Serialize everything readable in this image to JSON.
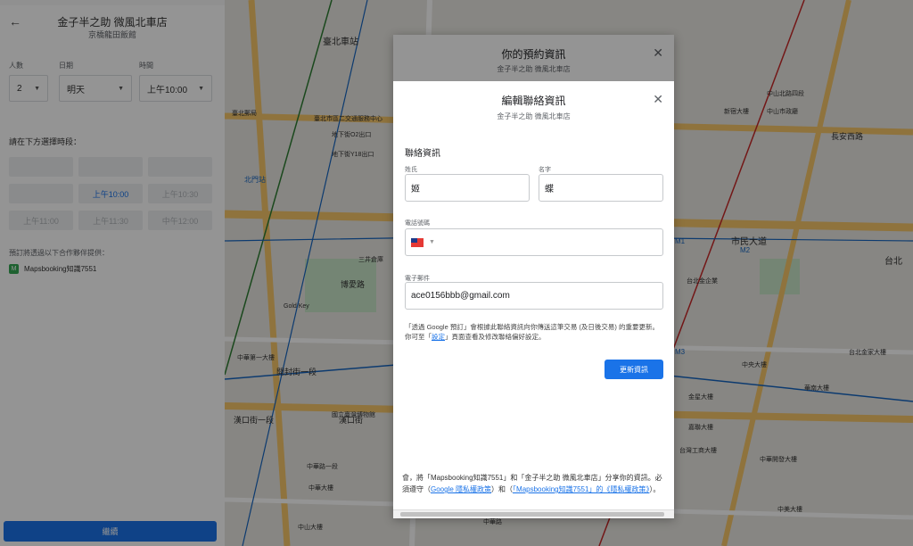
{
  "left_panel": {
    "restaurant_name": "金子半之助 微風北車店",
    "subtitle": "京橋龍田飯館",
    "party_size_label": "人數",
    "party_size_value": "2",
    "date_label": "日期",
    "date_value": "明天",
    "time_label": "時間",
    "time_value": "上午10:00",
    "slot_prompt": "請在下方選擇時段：",
    "slots": [
      "上午10:00",
      "上午10:30",
      "上午11:00",
      "上午11:30",
      "中午12:00"
    ],
    "provider_note": "預訂將透過以下合作夥伴提供：",
    "provider_name": "Mapsbooking知識7551",
    "continue_label": "繼續"
  },
  "map": {
    "labels": [
      "臺北車站",
      "北門站",
      "臺北郵局",
      "臺北市區二交通服務中心",
      "國立臺灣博物館",
      "博愛路",
      "Gold Key",
      "開封街一段",
      "漢口街一段",
      "漢口街",
      "中華路一段",
      "中華路",
      "中山北路四段",
      "長安西路",
      "中山市政廳",
      "地下街O2出口",
      "地下街Y18出口",
      "市民大道",
      "M2",
      "M1",
      "M3",
      "台北",
      "三井倉庫",
      "中華第一大樓",
      "台北金企業",
      "中央大樓",
      "金星大樓",
      "中美大樓",
      "中山大樓",
      "華南大樓",
      "台北金家大樓",
      "台灣工商大樓",
      "嘉聯大樓",
      "新宿大樓",
      "中華開發大樓",
      "中華大樓"
    ]
  },
  "booking_dialog": {
    "title": "你的預約資訊",
    "subtitle": "金子半之助 微風北車店",
    "footer_pre": "會，將「Mapsbooking知識7551」和「金子半之助 微風北車店」分享你的資訊。必須遵守（",
    "footer_link1": "Google 隱私權政策",
    "footer_mid": "）和（",
    "footer_link2": "「Mapsbooking知識7551」的《隱私權政策》",
    "footer_post": "）。"
  },
  "edit_dialog": {
    "title": "編輯聯絡資訊",
    "subtitle": "金子半之助 微風北車店",
    "section_title": "聯絡資訊",
    "last_name_label": "姓氏",
    "last_name_value": "姬",
    "first_name_label": "名字",
    "first_name_value": "蝶",
    "phone_label": "電話號碼",
    "phone_value": "",
    "email_label": "電子郵件",
    "email_value": "ace0156bbb@gmail.com",
    "privacy_pre": "「透過 Google 預訂」會根據此聯絡資訊向你傳送這筆交易 (及日後交易) 的重要更新。你可至「",
    "privacy_link": "設定",
    "privacy_post": "」頁面查看及修改聯絡偏好設定。",
    "update_label": "更新資訊"
  },
  "colors": {
    "accent": "#1a73e8",
    "map_bg": "#e9e7e2",
    "road_yellow": "#f6c76a",
    "rail_red": "#c62828",
    "rail_blue": "#1565c0",
    "park_green": "#c8e6c9"
  },
  "icons": [
    "back-arrow-icon",
    "close-icon",
    "caret-down-icon",
    "taiwan-flag-icon",
    "transit-icon",
    "provider-logo-icon"
  ]
}
